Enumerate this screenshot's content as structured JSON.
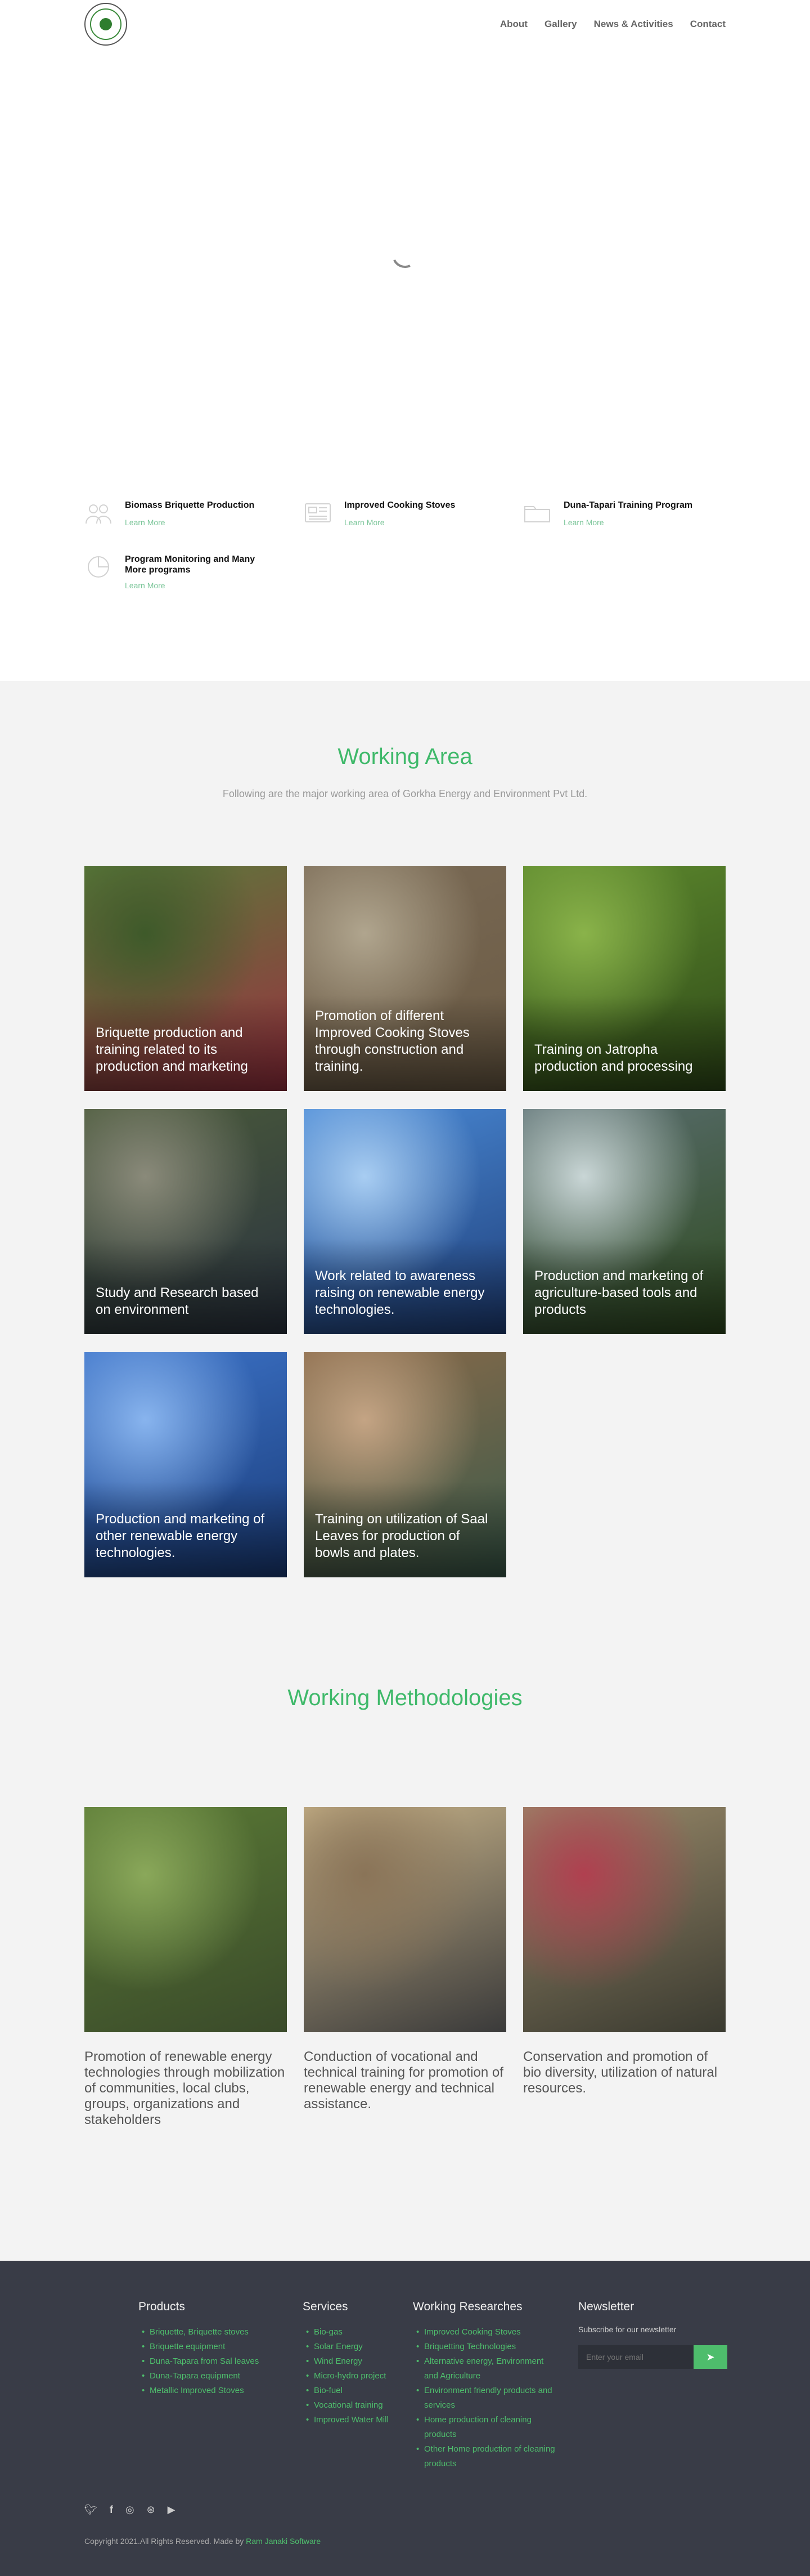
{
  "header": {
    "logo_icon": "organization-logo",
    "nav": [
      "About",
      "Gallery",
      "News & Activities",
      "Contact"
    ]
  },
  "hero": {
    "loader_icon": "loading-spinner-icon"
  },
  "services": [
    {
      "title": "Biomass Briquette Production",
      "link": "Learn More",
      "icon": "people-icon"
    },
    {
      "title": "Improved Cooking Stoves",
      "link": "Learn More",
      "icon": "newspaper-icon"
    },
    {
      "title": "Duna-Tapari Training Program",
      "link": "Learn More",
      "icon": "folder-icon"
    },
    {
      "title": "Program Monitoring and Many More programs",
      "link": "Learn More",
      "icon": "pie-chart-icon"
    }
  ],
  "working_area": {
    "title": "Working Area",
    "subtitle": "Following are the major working area of Gorkha Energy and Environment Pvt Ltd.",
    "cards": [
      {
        "text": "Briquette production and training related to its production and marketing",
        "colors": [
          "#5a7a3a",
          "#3e5a2a",
          "#9a3040"
        ]
      },
      {
        "text": "Promotion of different Improved Cooking Stoves through construction and training.",
        "colors": [
          "#7a6a55",
          "#b0a58e",
          "#6a5a44"
        ]
      },
      {
        "text": "Training on Jatropha production and processing",
        "colors": [
          "#5e8a2e",
          "#8ab34a",
          "#2f4a18"
        ]
      },
      {
        "text": "Study and Research based on environment",
        "colors": [
          "#4a5a3a",
          "#8a8a7a",
          "#2a3340"
        ]
      },
      {
        "text": "Work related to awareness raising on renewable energy technologies.",
        "colors": [
          "#4a8ad6",
          "#a8cdf2",
          "#1f3f7a"
        ]
      },
      {
        "text": "Production and marketing of agriculture-based tools and products",
        "colors": [
          "#5a6e70",
          "#c9d6d6",
          "#2e4a1e"
        ]
      },
      {
        "text": "Production and marketing of other renewable energy technologies.",
        "colors": [
          "#3d74c9",
          "#88b4ee",
          "#1a3c7a"
        ]
      },
      {
        "text": "Training on utilization of Saal Leaves for production of bowls and plates.",
        "colors": [
          "#8a6a4a",
          "#c4a484",
          "#3a5a4a"
        ]
      }
    ]
  },
  "methodologies": {
    "title": "Working Methodologies",
    "cards": [
      {
        "text": "Promotion of renewable energy technologies through mobilization of communities, local clubs, groups, organizations and stakeholders",
        "colors": [
          "#5a7a35",
          "#8aa85a",
          "#3a4a2a"
        ]
      },
      {
        "text": "Conduction of vocational and technical training for promotion of renewable energy and technical assistance.",
        "colors": [
          "#c9b48a",
          "#8a7458",
          "#3a3a3a"
        ]
      },
      {
        "text": "Conservation and promotion of bio diversity, utilization of natural resources.",
        "colors": [
          "#9a8a6a",
          "#b04050",
          "#3a3a30"
        ]
      }
    ]
  },
  "footer": {
    "products": {
      "title": "Products",
      "items": [
        "Briquette, Briquette stoves",
        "Briquette equipment",
        "Duna-Tapara from Sal leaves",
        "Duna-Tapara equipment",
        "Metallic Improved Stoves"
      ]
    },
    "services": {
      "title": "Services",
      "items": [
        "Bio-gas",
        "Solar Energy",
        "Wind Energy",
        "Micro-hydro project",
        "Bio-fuel",
        "Vocational training",
        "Improved Water Mill"
      ]
    },
    "research": {
      "title": "Working Researches",
      "items": [
        "Improved Cooking Stoves",
        "Briquetting Technologies",
        "Alternative energy, Environment and Agriculture",
        "Environment friendly products and services",
        "Home production of cleaning products",
        "Other Home production of cleaning products"
      ]
    },
    "newsletter": {
      "title": "Newsletter",
      "subtitle": "Subscribe for our newsletter",
      "placeholder": "Enter your email",
      "button_icon": "send-icon"
    },
    "social": [
      "twitter-icon",
      "facebook-icon",
      "instagram-icon",
      "dribbble-icon",
      "youtube-icon"
    ],
    "copyright_prefix": "Copyright 2021.All Rights Reserved. Made by ",
    "copyright_link": "Ram Janaki Software",
    "accent": "#4ebd6c"
  }
}
